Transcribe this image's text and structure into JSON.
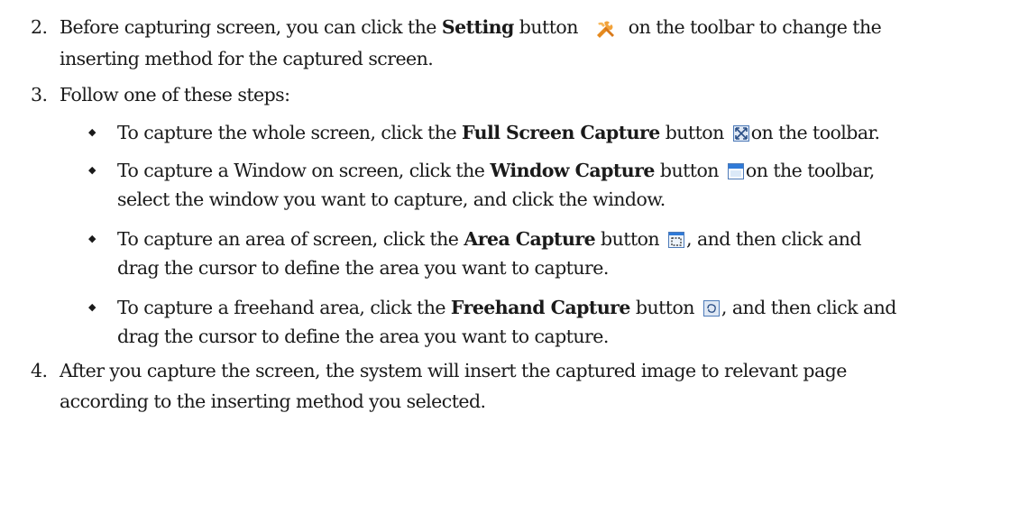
{
  "steps": [
    {
      "number": "2.",
      "pre": "Before capturing screen, you can click the ",
      "button_name": "Setting",
      "mid": " button",
      "post": " on the toolbar to change the",
      "cont": "inserting method for the captured screen.",
      "icon": "tools-icon"
    },
    {
      "number": "3.",
      "text": "Follow one of these steps:"
    },
    {
      "number": "4.",
      "line1": "After you capture the screen, the system will insert the captured image to relevant page",
      "line2": "according to the inserting method you selected."
    }
  ],
  "bullets": [
    {
      "pre": "To capture the whole screen, click the ",
      "button_name": "Full Screen Capture",
      "mid": " button ",
      "post": "on the toolbar.",
      "icon": "full-screen-capture-icon"
    },
    {
      "pre": "To capture a Window on screen, click the ",
      "button_name": "Window Capture",
      "mid": " button ",
      "post": "on the toolbar,",
      "cont": "select the window you want to capture, and click the window.",
      "icon": "window-capture-icon"
    },
    {
      "pre": "To capture an area of screen, click the ",
      "button_name": "Area Capture",
      "mid": " button ",
      "post": ", and then click and",
      "cont": "drag the cursor to define the area you want to capture.",
      "icon": "area-capture-icon"
    },
    {
      "pre": "To capture a freehand area, click the ",
      "button_name": "Freehand Capture",
      "mid": " button ",
      "post": ", and then click and",
      "cont": "drag the cursor to define the area you want to capture.",
      "icon": "freehand-capture-icon"
    }
  ],
  "bullet_glyph": "◆"
}
